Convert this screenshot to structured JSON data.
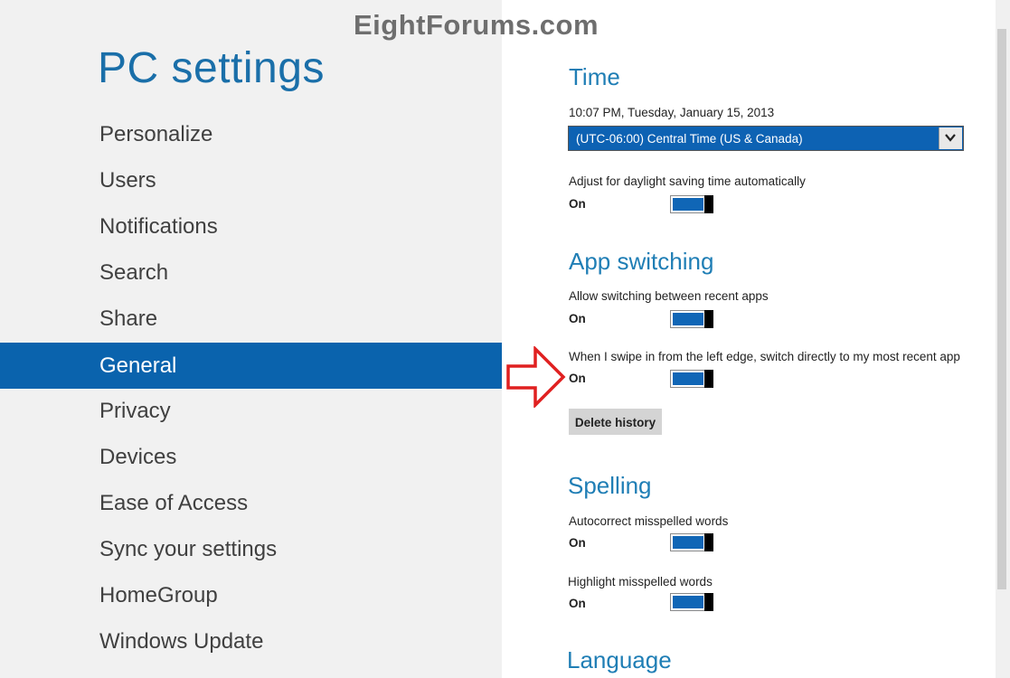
{
  "watermark": "EightForums.com",
  "title": "PC settings",
  "nav": {
    "items": [
      {
        "label": "Personalize",
        "selected": false
      },
      {
        "label": "Users",
        "selected": false
      },
      {
        "label": "Notifications",
        "selected": false
      },
      {
        "label": "Search",
        "selected": false
      },
      {
        "label": "Share",
        "selected": false
      },
      {
        "label": "General",
        "selected": true
      },
      {
        "label": "Privacy",
        "selected": false
      },
      {
        "label": "Devices",
        "selected": false
      },
      {
        "label": "Ease of Access",
        "selected": false
      },
      {
        "label": "Sync your settings",
        "selected": false
      },
      {
        "label": "HomeGroup",
        "selected": false
      },
      {
        "label": "Windows Update",
        "selected": false
      }
    ]
  },
  "time": {
    "heading": "Time",
    "current": "10:07 PM, Tuesday, January 15, 2013",
    "timezone": "(UTC-06:00) Central Time (US & Canada)",
    "dst_label": "Adjust for daylight saving time automatically",
    "dst_state": "On"
  },
  "app_switching": {
    "heading": "App switching",
    "allow_label": "Allow switching between recent apps",
    "allow_state": "On",
    "swipe_label": "When I swipe in from the left edge, switch directly to my most recent app",
    "swipe_state": "On",
    "delete_button": "Delete history"
  },
  "spelling": {
    "heading": "Spelling",
    "autocorrect_label": "Autocorrect misspelled words",
    "autocorrect_state": "On",
    "highlight_label": "Highlight misspelled words",
    "highlight_state": "On"
  },
  "language": {
    "heading": "Language"
  },
  "colors": {
    "accent": "#0a63ad",
    "heading": "#1f7eb5",
    "toggle_fill": "#1066b6",
    "annotation_arrow": "#e02020"
  },
  "icons": {
    "dropdown": "chevron-down-icon",
    "annotation": "right-arrow-icon"
  }
}
